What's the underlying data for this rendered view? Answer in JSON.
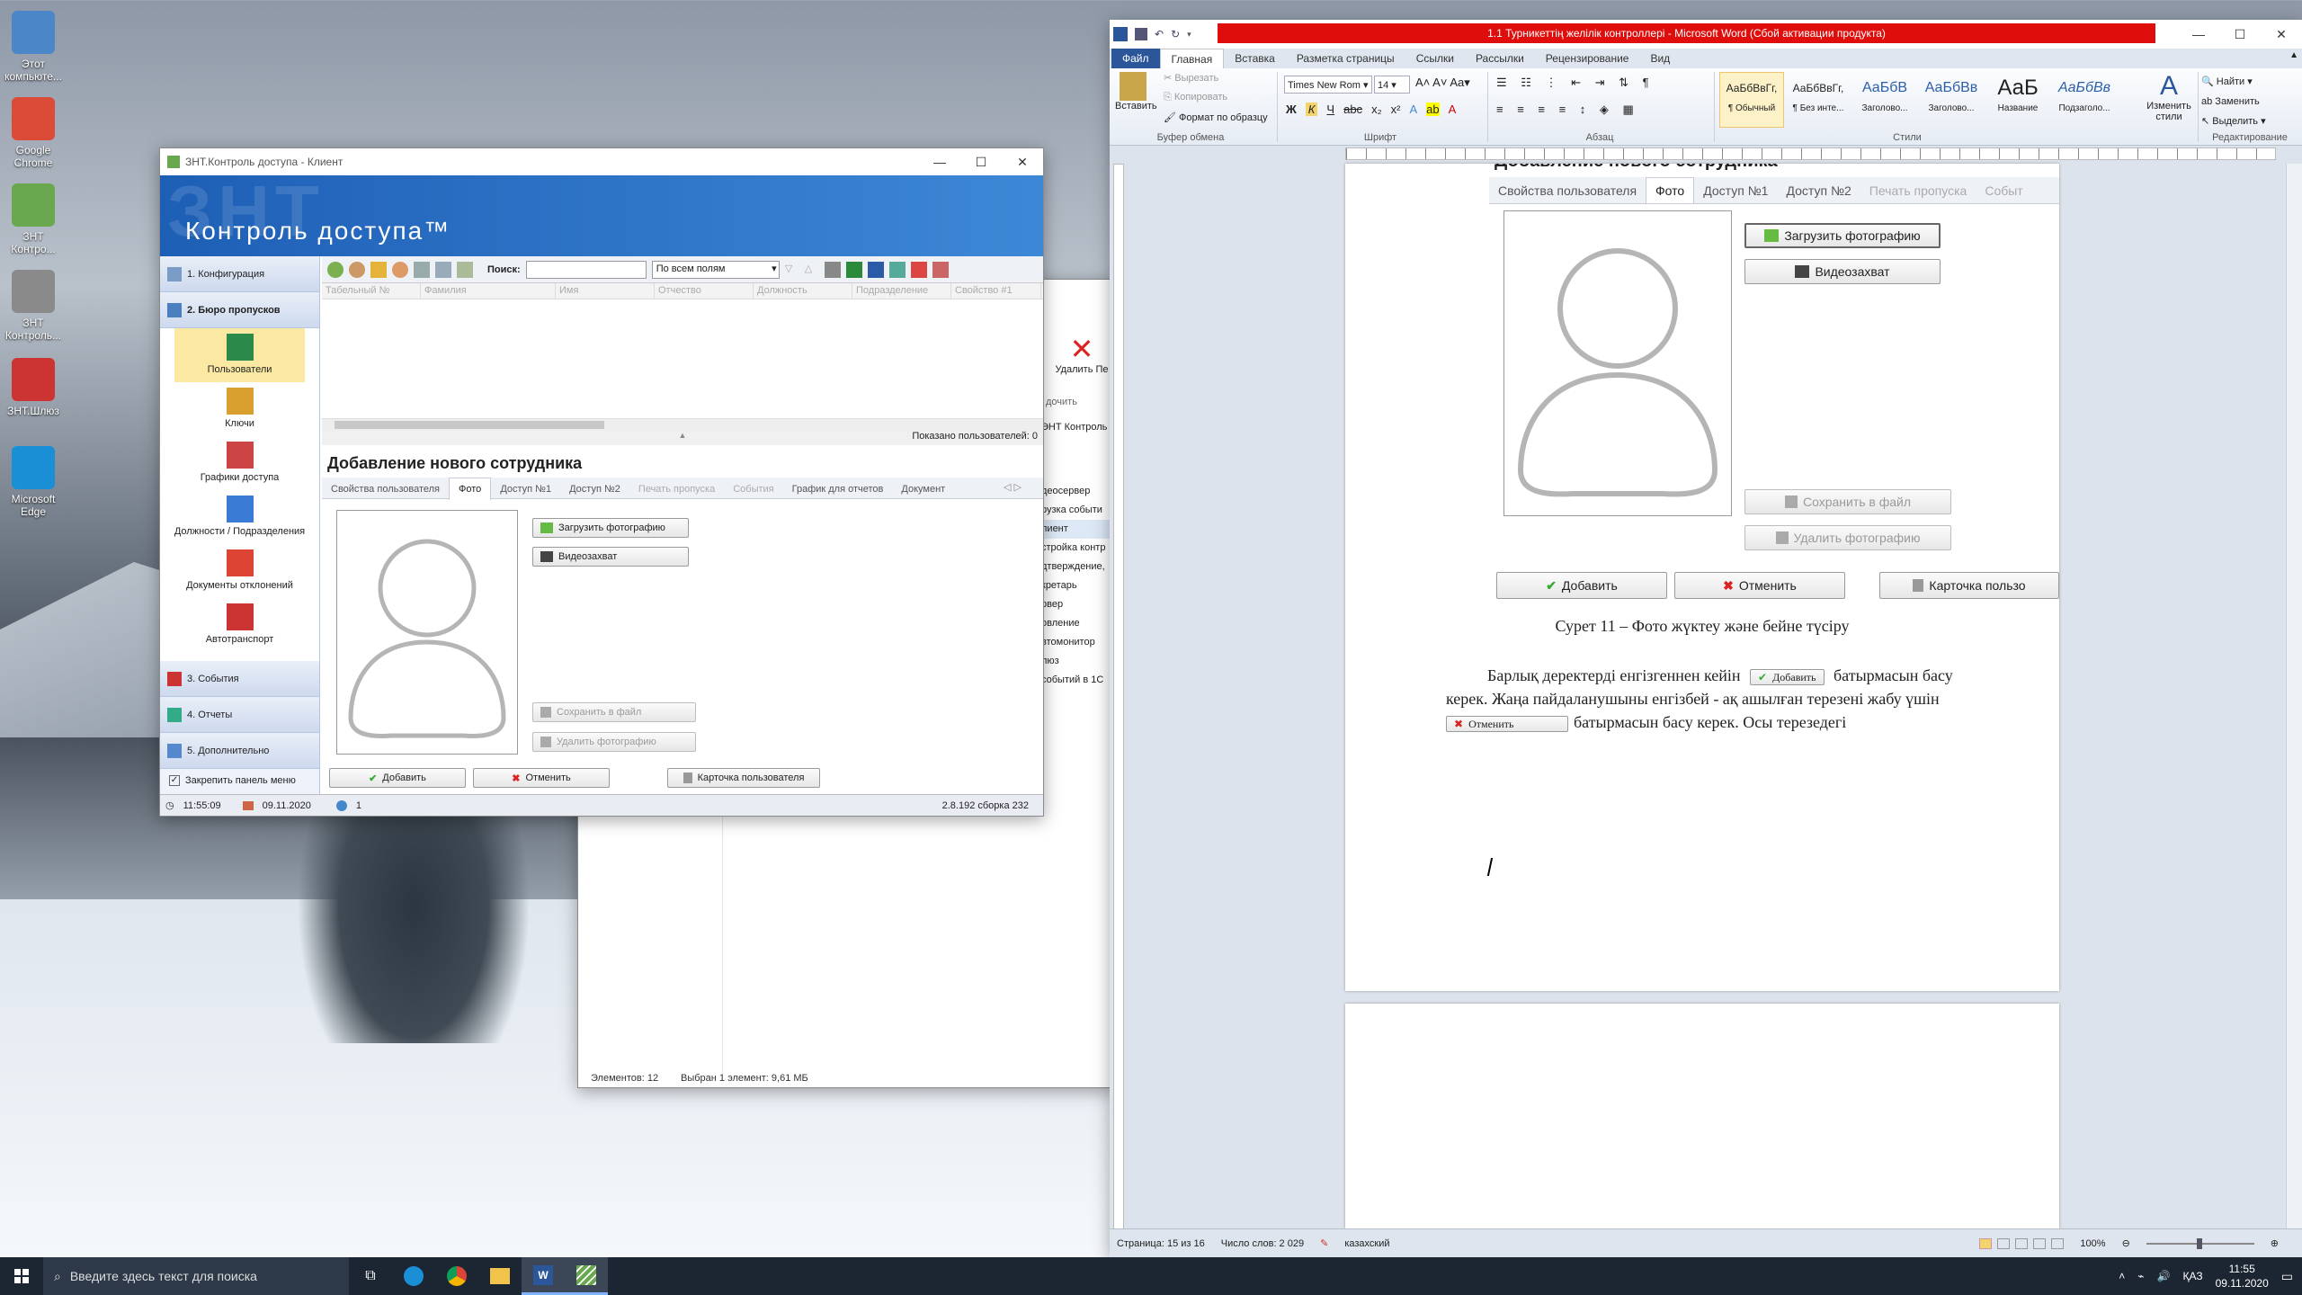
{
  "desktop": {
    "icons": [
      {
        "label": "Этот компьюте...",
        "color": "#4a86c8"
      },
      {
        "label": "Google Chrome",
        "color": "#dc4a38"
      },
      {
        "label": "ЗНТ Контро...",
        "color": "#6aa84f"
      },
      {
        "label": "ЗНТ Контроль...",
        "color": "#8a8a8a"
      },
      {
        "label": "ЗНТ.Шлюз",
        "color": "#cc3333"
      },
      {
        "label": "Microsoft Edge",
        "color": "#1a8fd6"
      }
    ]
  },
  "app": {
    "title": "ЗНТ.Контроль доступа - Клиент",
    "banner": "Контроль доступа™",
    "nav_groups": [
      "1. Конфигурация",
      "2. Бюро пропусков",
      "3. События",
      "4. Отчеты",
      "5. Дополнительно"
    ],
    "nav_items": [
      "Пользователи",
      "Ключи",
      "Графики доступа",
      "Должности / Подразделения",
      "Документы отклонений",
      "Автотранспорт"
    ],
    "pin_label": "Закрепить панель меню",
    "search_label": "Поиск:",
    "search_scope": "По всем полям",
    "columns": [
      "Табельный №",
      "Фамилия",
      "Имя",
      "Отчество",
      "Должность",
      "Подразделение",
      "Свойство #1"
    ],
    "shown_users": "Показано пользователей: 0",
    "form_title": "Добавление нового сотрудника",
    "tabs": [
      "Свойства пользователя",
      "Фото",
      "Доступ №1",
      "Доступ №2",
      "Печать пропуска",
      "События",
      "График для отчетов",
      "Документ"
    ],
    "btn_upload": "Загрузить фотографию",
    "btn_video": "Видеозахват",
    "btn_save": "Сохранить в файл",
    "btn_delete_photo": "Удалить фотографию",
    "btn_add": "Добавить",
    "btn_cancel": "Отменить",
    "btn_card": "Карточка пользователя",
    "status_time": "11:55:09",
    "status_date": "09.11.2020",
    "status_users": "1",
    "status_version": "2.8.192 сборка 232"
  },
  "explorer": {
    "delete_label": "Удалить",
    "delete_label2": "Пе",
    "order_label": "дочить",
    "items": [
      "ЭНТ Контроль",
      "деосервер",
      "рузка событи",
      "лиент",
      "стройка контр",
      "дтверждение,",
      "кретарь",
      "рвер",
      "овление",
      "втомонитор",
      "люз",
      "событий в 1С"
    ],
    "status_count": "Элементов: 12",
    "status_selected": "Выбран 1 элемент: 9,61 МБ"
  },
  "word": {
    "title": "1.1 Турникеттің желілік контроллері - Microsoft Word (Сбой активации продукта)",
    "tabs": [
      "Файл",
      "Главная",
      "Вставка",
      "Разметка страницы",
      "Ссылки",
      "Рассылки",
      "Рецензирование",
      "Вид"
    ],
    "clipboard": {
      "paste": "Вставить",
      "cut": "Вырезать",
      "copy": "Копировать",
      "format": "Формат по образцу",
      "label": "Буфер обмена"
    },
    "font": {
      "name": "Times New Rom",
      "size": "14",
      "label": "Шрифт"
    },
    "paragraph_label": "Абзац",
    "styles": [
      {
        "sample": "АаБбВвГг,",
        "name": "¶ Обычный"
      },
      {
        "sample": "АаБбВвГг,",
        "name": "¶ Без инте..."
      },
      {
        "sample": "АаБбВ",
        "name": "Заголово..."
      },
      {
        "sample": "АаБбВв",
        "name": "Заголово..."
      },
      {
        "sample": "АаБ",
        "name": "Название"
      },
      {
        "sample": "АаБбВв",
        "name": "Подзаголо..."
      }
    ],
    "styles_label": "Стили",
    "change_styles": "Изменить стили",
    "editing": {
      "find": "Найти",
      "replace": "Заменить",
      "select": "Выделить",
      "label": "Редактирование"
    },
    "doc": {
      "heading": "Добавление нового сотрудника",
      "tabs": [
        "Свойства пользователя",
        "Фото",
        "Доступ №1",
        "Доступ №2",
        "Печать пропуска",
        "Событ"
      ],
      "upload": "Загрузить фотографию",
      "video": "Видеозахват",
      "save": "Сохранить в файл",
      "delete": "Удалить фотографию",
      "add": "Добавить",
      "cancel": "Отменить",
      "card": "Карточка пользо",
      "caption": "Сурет 11 – Фото жүктеу және бейне түсіру",
      "p1a": "Барлық  деректерді енгізгеннен кейін",
      "p1b": "батырмасын басу",
      "p2": "керек. Жаңа пайдаланушыны енгізбей - ақ ашылған терезені жабу үшін",
      "p3": "батырмасын басу керек. Осы терезедегі",
      "inline_add": "Добавить",
      "inline_cancel": "Отменить"
    },
    "status": {
      "page": "Страница: 15 из 16",
      "words": "Число слов: 2 029",
      "lang": "казахский",
      "zoom": "100%"
    }
  },
  "taskbar": {
    "search_placeholder": "Введите здесь текст для поиска",
    "lang": "ҚАЗ",
    "time": "11:55",
    "date": "09.11.2020"
  }
}
